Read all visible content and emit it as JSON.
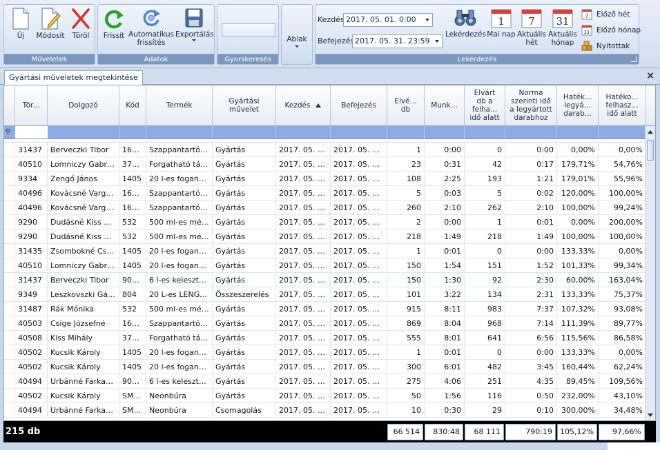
{
  "ribbon": {
    "groups": {
      "muveletek": "Műveletek",
      "adatok": "Adatok",
      "gyorskereses": "Gyorskeresés",
      "lekerdezes": "Lekérdezés"
    },
    "buttons": {
      "uj": "Új",
      "modosit": "Módosít",
      "torol": "Töröl",
      "frissit": "Frissít",
      "auto_frissites_1": "Automatikus",
      "auto_frissites_2": "frissítés",
      "exportalas": "Exportálás",
      "ablak": "Ablak",
      "lekerdezes": "Lekérdezés",
      "mai_nap": "Mai nap",
      "aktualis_het_1": "Aktuális",
      "aktualis_het_2": "hét",
      "aktualis_honap_1": "Aktuális",
      "aktualis_honap_2": "hónap",
      "elozo_het": "Előző hét",
      "elozo_honap": "Előző hónap",
      "nyitottak": "Nyitottak"
    },
    "calendar_numbers": {
      "mai_nap": "1",
      "aktualis_het": "7",
      "aktualis_honap": "31",
      "elozo_het": "7",
      "elozo_honap": "31"
    },
    "search_value": "",
    "kezdes_label": "Kezdés",
    "kezdes_value": "2017. 05. 01. 0:00",
    "befejezes_label": "Befejezés",
    "befejezes_value": "2017. 05. 31. 23:59"
  },
  "tab": {
    "title": "Gyártási műveletek megtekintése"
  },
  "columns": {
    "c0": "Tör...",
    "c1": "Dolgozó",
    "c2": "Kód",
    "c3": "Termék",
    "c4_1": "Gyártási",
    "c4_2": "művelet",
    "c5": "Kezdés",
    "c6": "Befejezés",
    "c7_1": "Elvé...",
    "c7_2": "db",
    "c8": "Munk...",
    "c9_1": "Elvárt",
    "c9_2": "db a",
    "c9_3": "felha...",
    "c9_4": "idő alatt",
    "c10_1": "Norma",
    "c10_2": "szerinti idő",
    "c10_3": "a legyártott",
    "c10_4": "darabhoz",
    "c11_1": "Haték...",
    "c11_2": "legyá...",
    "c11_3": "darab...",
    "c12_1": "Hatéko...",
    "c12_2": "felhasz...",
    "c12_3": "idő alatt"
  },
  "rows": [
    [
      "31437",
      "Berveczki Tibor",
      "161...",
      "Szappantartó g...",
      "Gyártás",
      "2017. 05. 0...",
      "2017. 05. 04...",
      "1",
      "0:00",
      "0",
      "0:00",
      "0,00%",
      "0,00%"
    ],
    [
      "40510",
      "Lomniczy Gabriella",
      "370...",
      "Forgatható tár...",
      "Gyártás",
      "2017. 05. 0...",
      "2017. 05. 04...",
      "23",
      "0:31",
      "42",
      "0:17",
      "179,71%",
      "54,76%"
    ],
    [
      "9334",
      "Zengő János",
      "1405",
      "20 l-es foganty...",
      "Gyártás",
      "2017. 05. 0...",
      "2017. 05. 04...",
      "108",
      "2:25",
      "193",
      "1:21",
      "179,01%",
      "55,96%"
    ],
    [
      "40496",
      "Kovácsné Varga Il...",
      "161...",
      "Szappantartó g...",
      "Gyártás",
      "2017. 05. 0...",
      "2017. 05. 04...",
      "5",
      "0:03",
      "5",
      "0:02",
      "120,00%",
      "100,00%"
    ],
    [
      "40496",
      "Kovácsné Varga Il...",
      "161...",
      "Szappantartó g...",
      "Gyártás",
      "2017. 05. 0...",
      "2017. 05. 04...",
      "260",
      "2:10",
      "262",
      "2:10",
      "100,00%",
      "99,24%"
    ],
    [
      "9290",
      "Dudásné Kiss Erzs...",
      "532",
      "500 ml-es mérc...",
      "Gyártás",
      "2017. 05. 0...",
      "2017. 05. 04...",
      "2",
      "0:00",
      "1",
      "0:01",
      "0,00%",
      "200,00%"
    ],
    [
      "9290",
      "Dudásné Kiss Erzs...",
      "532",
      "500 ml-es mérc...",
      "Gyártás",
      "2017. 05. 0...",
      "2017. 05. 04...",
      "218",
      "1:49",
      "218",
      "1:49",
      "100,00%",
      "100,00%"
    ],
    [
      "31435",
      "Zsombokné Csörg...",
      "1405",
      "20 l-es foganty...",
      "Gyártás",
      "2017. 05. 0...",
      "2017. 05. 04...",
      "1",
      "0:01",
      "0",
      "0:00",
      "133,33%",
      "0,00%"
    ],
    [
      "40510",
      "Lomniczy Gabriella",
      "1405",
      "20 l-es foganty...",
      "Gyártás",
      "2017. 05. 0...",
      "2017. 05. 04...",
      "150",
      "1:54",
      "151",
      "1:52",
      "101,33%",
      "99,34%"
    ],
    [
      "31437",
      "Berveczki Tibor",
      "900...",
      "6 l-es keleszto t...",
      "Gyártás",
      "2017. 05. 0...",
      "2017. 05. 04...",
      "150",
      "1:30",
      "92",
      "2:30",
      "60,00%",
      "163,04%"
    ],
    [
      "9349",
      "Leszkovszki Gábo...",
      "804",
      "20 L-es LENGYE...",
      "Összeszerelés",
      "2017. 05. 0...",
      "2017. 05. 04...",
      "101",
      "3:22",
      "134",
      "2:31",
      "133,33%",
      "75,37%"
    ],
    [
      "31487",
      "Rák Mónika",
      "532",
      "500 ml-es mérc...",
      "Gyártás",
      "2017. 05. 0...",
      "2017. 05. 04...",
      "915",
      "8:11",
      "983",
      "7:37",
      "107,32%",
      "93,08%"
    ],
    [
      "40503",
      "Csige Józsefné",
      "161...",
      "Szappantartó g...",
      "Gyártás",
      "2017. 05. 0...",
      "2017. 05. 04...",
      "869",
      "8:04",
      "968",
      "7:14",
      "111,39%",
      "89,77%"
    ],
    [
      "40508",
      "Kiss Mihály",
      "370...",
      "Forgatható tár...",
      "Gyártás",
      "2017. 05. 0...",
      "2017. 05. 04...",
      "555",
      "8:01",
      "641",
      "6:56",
      "115,56%",
      "86,58%"
    ],
    [
      "40502",
      "Kucsik Károly",
      "1405",
      "20 l-es foganty...",
      "Gyártás",
      "2017. 05. 0...",
      "2017. 05. 04...",
      "1",
      "0:01",
      "0",
      "0:00",
      "133,33%",
      "0,00%"
    ],
    [
      "40502",
      "Kucsik Károly",
      "1405",
      "20 l-es foganty...",
      "Gyártás",
      "2017. 05. 0...",
      "2017. 05. 04...",
      "300",
      "6:01",
      "482",
      "3:45",
      "160,44%",
      "62,24%"
    ],
    [
      "40494",
      "Urbánné Farkas I...",
      "900...",
      "6 l-es keleszto t...",
      "Gyártás",
      "2017. 05. 0...",
      "2017. 05. 04...",
      "275",
      "4:06",
      "251",
      "4:35",
      "89,45%",
      "109,56%"
    ],
    [
      "40502",
      "Kucsik Károly",
      "SM...",
      "Neonbúra",
      "Gyártás",
      "2017. 05. 0...",
      "2017. 05. 04...",
      "50",
      "1:56",
      "116",
      "0:50",
      "232,00%",
      "43,10%"
    ],
    [
      "40494",
      "Urbánné Farkas I...",
      "SM...",
      "Neonbúra",
      "Csomagolás",
      "2017. 05. 0...",
      "2017. 05. 04...",
      "10",
      "0:30",
      "29",
      "0:10",
      "300,00%",
      "34,48%"
    ]
  ],
  "footer": {
    "total": "215 db",
    "elvegzett_db": "66 514",
    "munkaido": "830:48",
    "elvart_db": "68 111",
    "norma_ido": "790:19",
    "hatekonysag_db": "105,12%",
    "hatekonysag_ido": "97,66%"
  },
  "colors": {
    "filter_row": "#8eabe3",
    "group_label": "#7c97bf",
    "footer_bg": "#000000"
  }
}
